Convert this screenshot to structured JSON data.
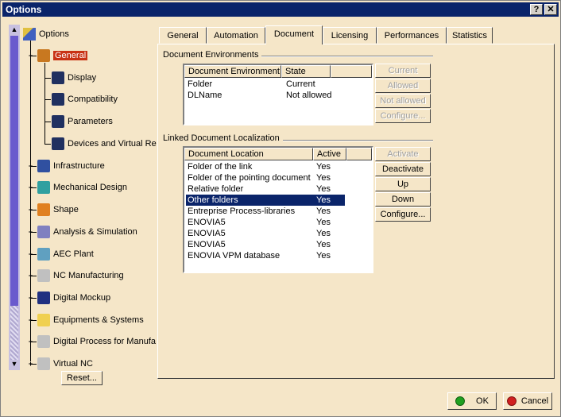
{
  "window": {
    "title": "Options"
  },
  "titlebar": {
    "help_label": "?",
    "close_label": "✕"
  },
  "tree": {
    "root": "Options",
    "items": [
      {
        "label": "General",
        "icon": "general-icon",
        "color": "#c87820"
      },
      {
        "label": "Display",
        "icon": "display-icon",
        "color": "#203060"
      },
      {
        "label": "Compatibility",
        "icon": "compatibility-icon",
        "color": "#203060"
      },
      {
        "label": "Parameters",
        "icon": "parameters-icon",
        "color": "#203060"
      },
      {
        "label": "Devices and Virtual Re",
        "icon": "devices-icon",
        "color": "#203060"
      },
      {
        "label": "Infrastructure",
        "icon": "infrastructure-icon",
        "color": "#3050a0"
      },
      {
        "label": "Mechanical Design",
        "icon": "mechanical-design-icon",
        "color": "#30a0a0"
      },
      {
        "label": "Shape",
        "icon": "shape-icon",
        "color": "#e08020"
      },
      {
        "label": "Analysis & Simulation",
        "icon": "analysis-icon",
        "color": "#8080c0"
      },
      {
        "label": "AEC Plant",
        "icon": "aec-plant-icon",
        "color": "#60a0c0"
      },
      {
        "label": "NC Manufacturing",
        "icon": "nc-manufacturing-icon",
        "color": "#c0c0c0"
      },
      {
        "label": "Digital Mockup",
        "icon": "digital-mockup-icon",
        "color": "#203080"
      },
      {
        "label": "Equipments & Systems",
        "icon": "equipments-icon",
        "color": "#f0d050"
      },
      {
        "label": "Digital Process for Manufa",
        "icon": "digital-process-icon",
        "color": "#c0c0c0"
      },
      {
        "label": "Virtual NC",
        "icon": "virtual-nc-icon",
        "color": "#c0c0c0"
      }
    ],
    "reset_label": "Reset..."
  },
  "tabs": [
    "General",
    "Automation",
    "Document",
    "Licensing",
    "Performances",
    "Statistics"
  ],
  "active_tab": "Document",
  "doc_env": {
    "title": "Document Environments",
    "columns": [
      "Document Environment",
      "State"
    ],
    "rows": [
      [
        "Folder",
        "Current"
      ],
      [
        "DLName",
        "Not allowed"
      ]
    ],
    "buttons": [
      "Current",
      "Allowed",
      "Not allowed",
      "Configure..."
    ]
  },
  "linked": {
    "title": "Linked Document Localization",
    "columns": [
      "Document Location",
      "Active"
    ],
    "rows": [
      [
        "Folder of the link",
        "Yes"
      ],
      [
        "Folder of the pointing document",
        "Yes"
      ],
      [
        "Relative folder",
        "Yes"
      ],
      [
        "Other folders",
        "Yes"
      ],
      [
        "Entreprise Process-libraries",
        "Yes"
      ],
      [
        "ENOVIA5",
        "Yes"
      ],
      [
        "ENOVIA5",
        "Yes"
      ],
      [
        "ENOVIA5",
        "Yes"
      ],
      [
        "ENOVIA VPM  database",
        "Yes"
      ]
    ],
    "selected_row": 3,
    "buttons": [
      "Activate",
      "Deactivate",
      "Up",
      "Down",
      "Configure..."
    ]
  },
  "footer": {
    "ok_label": "OK",
    "cancel_label": "Cancel"
  },
  "colors": {
    "ok": "#20a020",
    "cancel": "#d02020",
    "selection": "#0a246a",
    "tree_selection": "#c83214"
  }
}
